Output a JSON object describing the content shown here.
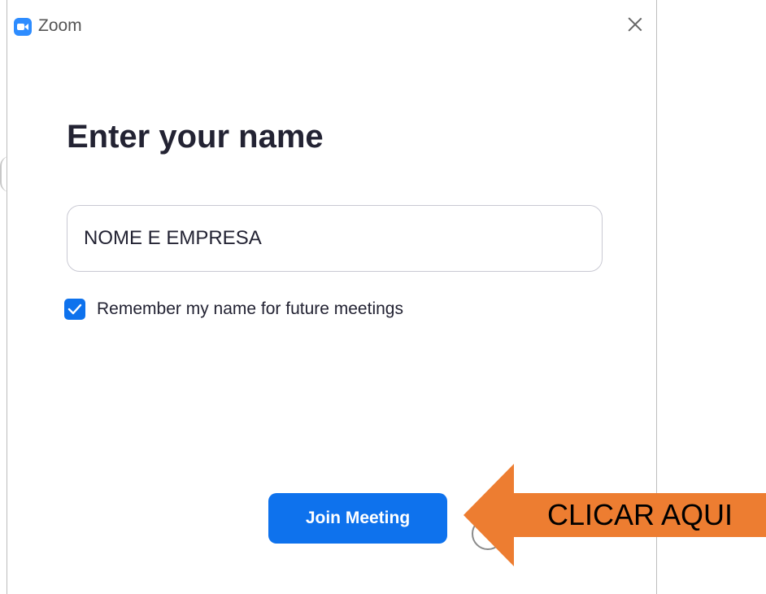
{
  "window": {
    "app_title": "Zoom",
    "close_icon": "close-icon",
    "app_icon": "zoom-camera-icon"
  },
  "dialog": {
    "heading": "Enter your name",
    "name_input": {
      "value": "NOME E EMPRESA",
      "placeholder": ""
    },
    "remember": {
      "label": "Remember my name for future meetings",
      "checked": true
    },
    "join_button_label": "Join Meeting"
  },
  "annotation": {
    "label": "CLICAR AQUI",
    "color": "#ED7D31",
    "icon": "left-arrow-icon"
  },
  "colors": {
    "accent": "#0E72ED",
    "zoom_brand": "#2D8CFF",
    "heading_text": "#232333"
  }
}
